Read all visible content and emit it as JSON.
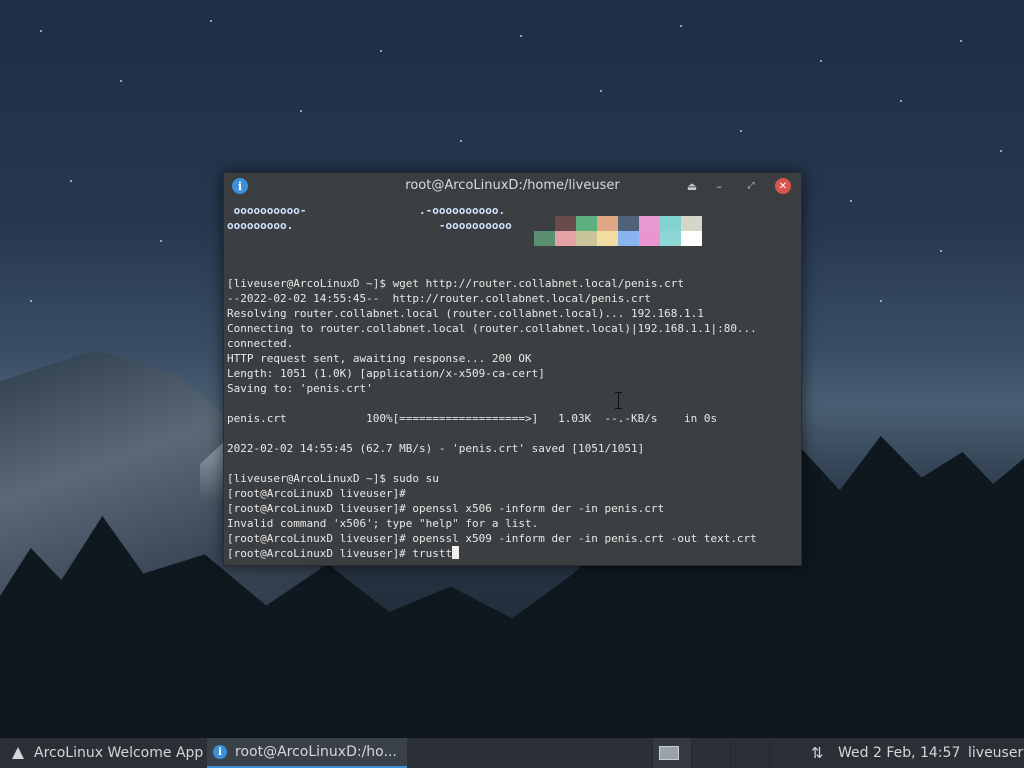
{
  "window": {
    "title": "root@ArcoLinuxD:/home/liveuser",
    "buttons": {
      "shade": "⏏",
      "minimize": "–",
      "maximize": "⤢",
      "close": "✕"
    }
  },
  "terminal": {
    "neofetch": [
      " oooooooooo-                 .-oooooooooo.",
      "ooooooooo.                      -oooooooooo"
    ],
    "palette_row1": [
      "#3c3f41",
      "#6b4a4e",
      "#5cb07e",
      "#e0a986",
      "#4f6278",
      "#e89ad0",
      "#83d4cf",
      "#d6d6c8"
    ],
    "palette_row2": [
      "#5c8f72",
      "#e4a1a6",
      "#c9c49a",
      "#f2dea2",
      "#8ab4f0",
      "#e995cf",
      "#8fd7d4",
      "#ffffff"
    ],
    "lines": [
      "[liveuser@ArcoLinuxD ~]$ wget http://router.collabnet.local/penis.crt",
      "--2022-02-02 14:55:45--  http://router.collabnet.local/penis.crt",
      "Resolving router.collabnet.local (router.collabnet.local)... 192.168.1.1",
      "Connecting to router.collabnet.local (router.collabnet.local)|192.168.1.1|:80...",
      "connected.",
      "HTTP request sent, awaiting response... 200 OK",
      "Length: 1051 (1.0K) [application/x-x509-ca-cert]",
      "Saving to: 'penis.crt'",
      "",
      "penis.crt            100%[===================>]   1.03K  --.-KB/s    in 0s",
      "",
      "2022-02-02 14:55:45 (62.7 MB/s) - 'penis.crt' saved [1051/1051]",
      "",
      "[liveuser@ArcoLinuxD ~]$ sudo su",
      "[root@ArcoLinuxD liveuser]#",
      "[root@ArcoLinuxD liveuser]# openssl x506 -inform der -in penis.crt",
      "Invalid command 'x506'; type \"help\" for a list.",
      "[root@ArcoLinuxD liveuser]# openssl x509 -inform der -in penis.crt -out text.crt"
    ],
    "prompt_line": "[root@ArcoLinuxD liveuser]# trustt"
  },
  "taskbar": {
    "welcome_app": "ArcoLinux Welcome App",
    "terminal_task": "root@ArcoLinuxD:/ho...",
    "network_icon": "⇅",
    "clock": "Wed  2 Feb, 14:57",
    "user": "liveuser"
  },
  "colors": {
    "terminal_bg": "#3c3f41",
    "accent": "#3d8fd8",
    "close": "#d9534f",
    "taskbar_bg": "#2b3036"
  }
}
